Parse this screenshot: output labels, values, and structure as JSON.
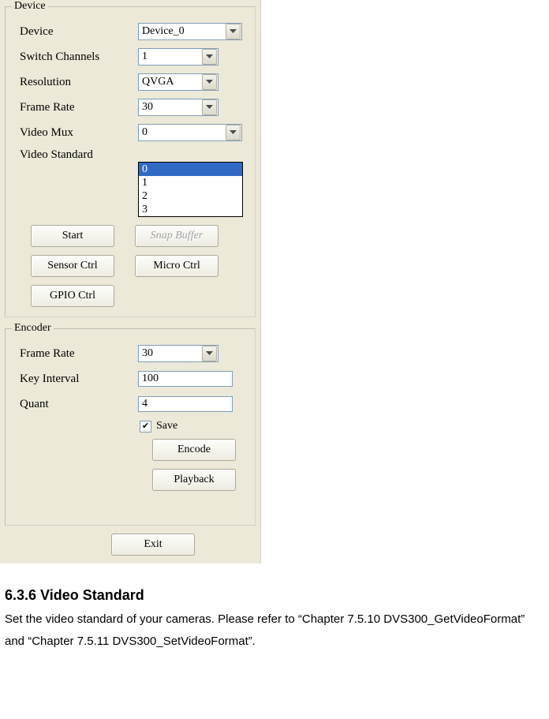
{
  "device_group": {
    "legend": "Device",
    "fields": {
      "device": {
        "label": "Device",
        "value": "Device_0"
      },
      "switch_channels": {
        "label": "Switch Channels",
        "value": "1"
      },
      "resolution": {
        "label": "Resolution",
        "value": "QVGA"
      },
      "frame_rate": {
        "label": "Frame Rate",
        "value": "30"
      },
      "video_mux": {
        "label": "Video Mux",
        "value": "0",
        "options": [
          "0",
          "1",
          "2",
          "3"
        ],
        "selected_index": 0
      },
      "video_standard": {
        "label": "Video Standard"
      }
    },
    "buttons": {
      "start": "Start",
      "snap_buffer": "Snap Buffer",
      "sensor_ctrl": "Sensor Ctrl",
      "micro_ctrl": "Micro Ctrl",
      "gpio_ctrl": "GPIO Ctrl"
    }
  },
  "encoder_group": {
    "legend": "Encoder",
    "fields": {
      "frame_rate": {
        "label": "Frame Rate",
        "value": "30"
      },
      "key_interval": {
        "label": "Key Interval",
        "value": "100"
      },
      "quant": {
        "label": "Quant",
        "value": "4"
      }
    },
    "save_label": "Save",
    "save_checked": true,
    "buttons": {
      "encode": "Encode",
      "playback": "Playback"
    }
  },
  "exit_label": "Exit",
  "doc": {
    "heading": "6.3.6 Video Standard",
    "body": "Set the video standard of your cameras. Please refer to “Chapter 7.5.10 DVS300_GetVideoFormat” and “Chapter 7.5.11 DVS300_SetVideoFormat”."
  }
}
